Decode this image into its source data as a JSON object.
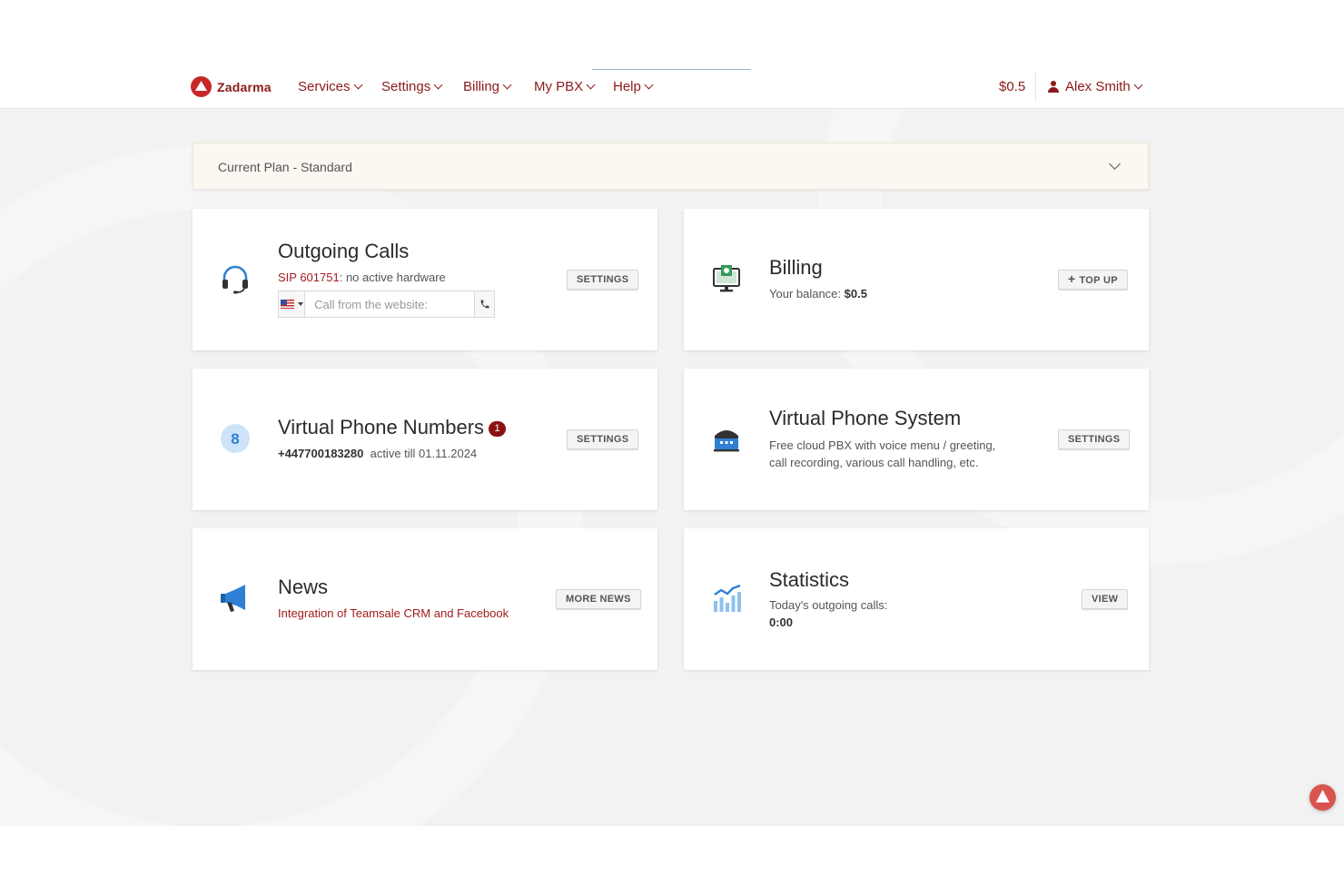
{
  "header": {
    "logo_text": "Zadarma",
    "nav": [
      {
        "label": "Services"
      },
      {
        "label": "Settings"
      },
      {
        "label": "Billing"
      },
      {
        "label": "My PBX"
      },
      {
        "label": "Help"
      }
    ],
    "balance": "$0.5",
    "user_name": "Alex Smith"
  },
  "plan": {
    "label": "Current Plan - Standard"
  },
  "cards": {
    "outgoing": {
      "title": "Outgoing Calls",
      "sip": "SIP 601751",
      "status": ": no active hardware",
      "call_placeholder": "Call from the website:",
      "button": "SETTINGS"
    },
    "billing": {
      "title": "Billing",
      "balance_label": "Your balance: ",
      "balance_value": "$0.5",
      "button": "TOP UP"
    },
    "numbers": {
      "title": "Virtual Phone Numbers",
      "badge": "1",
      "number": "+447700183280",
      "active": "active till 01.11.2024",
      "icon_digit": "8",
      "button": "SETTINGS"
    },
    "pbx": {
      "title": "Virtual Phone System",
      "line1": "Free cloud PBX with voice menu / greeting,",
      "line2": "call recording, various call handling, etc.",
      "button": "SETTINGS"
    },
    "news": {
      "title": "News",
      "headline": "Integration of Teamsale CRM and Facebook",
      "button": "MORE NEWS"
    },
    "stats": {
      "title": "Statistics",
      "label": "Today's outgoing calls:",
      "value": "0:00",
      "button": "VIEW"
    }
  },
  "colors": {
    "brand": "#8b1a1a",
    "accent_red": "#c62828",
    "icon_blue": "#2f7fd4",
    "background": "#f2f2f2"
  }
}
